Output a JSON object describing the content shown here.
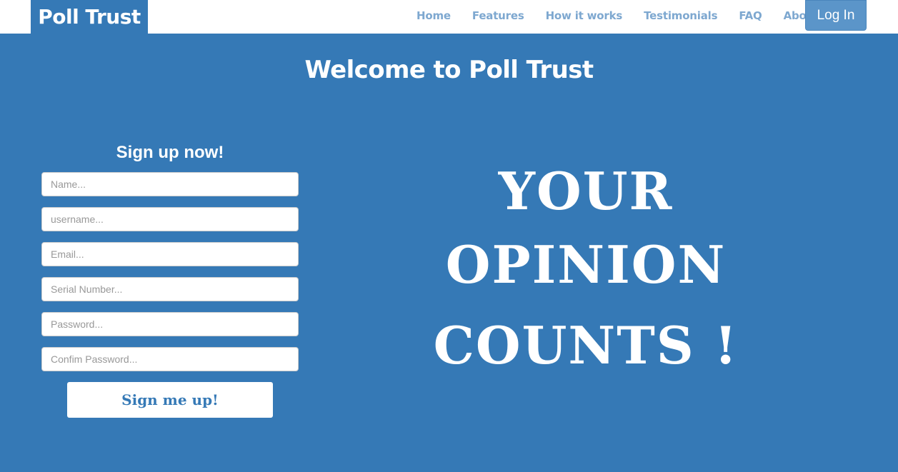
{
  "navbar": {
    "brand": "Poll Trust",
    "links": [
      "Home",
      "Features",
      "How it works",
      "Testimonials",
      "FAQ",
      "About-us"
    ],
    "login_label": "Log In"
  },
  "hero": {
    "welcome": "Welcome to Poll Trust"
  },
  "signup": {
    "title": "Sign up now!",
    "fields": {
      "name": "Name...",
      "username": "username...",
      "email": "Email...",
      "serial": "Serial Number...",
      "password": "Password...",
      "confirm": "Confim Password..."
    },
    "submit_label": "Sign me up!"
  },
  "slogan": {
    "line1": "YOUR",
    "line2": "OPINION",
    "line3": "COUNTS !"
  },
  "colors": {
    "primary": "#3579b6",
    "nav_link": "#7ea8d0",
    "login_bg": "#5b95c9",
    "text_light": "#ffffff"
  }
}
